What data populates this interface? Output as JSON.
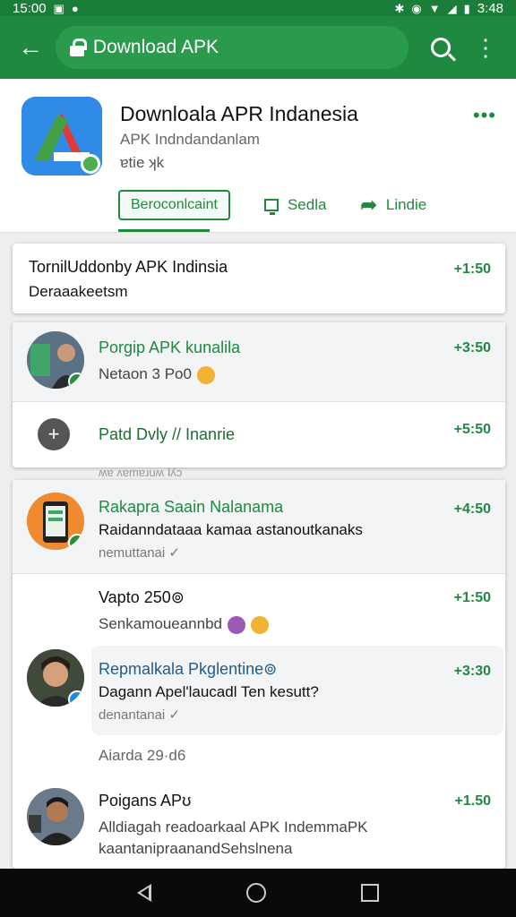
{
  "status_bar": {
    "time_left": "15:00",
    "time_right": "3:48"
  },
  "app_bar": {
    "url_text": "Download APK",
    "back_icon": "arrow-left-icon",
    "search_icon": "search-icon",
    "menu_icon": "more-vert-icon"
  },
  "header": {
    "title": "Downloala APR Indanesia",
    "subtitle": "APK Indndandanlam",
    "meta": "ɐtie ʞk",
    "primary_button": "Beroconlcaint",
    "action_2": "Sedla",
    "action_3": "Lindie",
    "colors": {
      "primary": "#1f8a3f",
      "app_bar": "#1f8a3f"
    }
  },
  "list": {
    "top_card": {
      "title": "TornilUddonby APK Indinsia",
      "subtitle": "Deraaakeetsm",
      "amount": "+1:50"
    },
    "card2": {
      "item1": {
        "title": "Porgip APK kunalila",
        "subtitle": "Netaon 3 Po0",
        "amount": "+3:50"
      },
      "item2": {
        "title": "Patd Dvly // Inanrie",
        "amount": "+5:50"
      },
      "clipped_text": "ʍɐ ʌɐmɐɹuʍ ʇʎɔ"
    },
    "card3": {
      "item1": {
        "title": "Rakapra Saain Nalanama",
        "subtitle": "Raidanndataaa kamaa astanoutkanaks",
        "meta": "nemuttanai ✓",
        "amount": "+4:50"
      },
      "item2": {
        "title": "Vapto 250⊚",
        "subtitle": "Senkamoueannbd",
        "amount": "+1:50"
      },
      "item3": {
        "title": "Repmalkala Pkglentine⊚",
        "subtitle": "Dagann Apel'laucadl Ten kesutt?",
        "meta": "denantanai ✓",
        "amount": "+3:30"
      },
      "section_label": "Aiarda 29·d6",
      "item4": {
        "title": "Poigans APʊ",
        "subtitle": "Alldiagah readoarkaal APK IndemmaPK",
        "subtitle2": "kaantanipraanandSehslnena",
        "amount": "+1.50"
      }
    }
  },
  "nav": {
    "back_icon": "nav-back-icon",
    "home_icon": "nav-home-icon",
    "recent_icon": "nav-recent-icon"
  }
}
